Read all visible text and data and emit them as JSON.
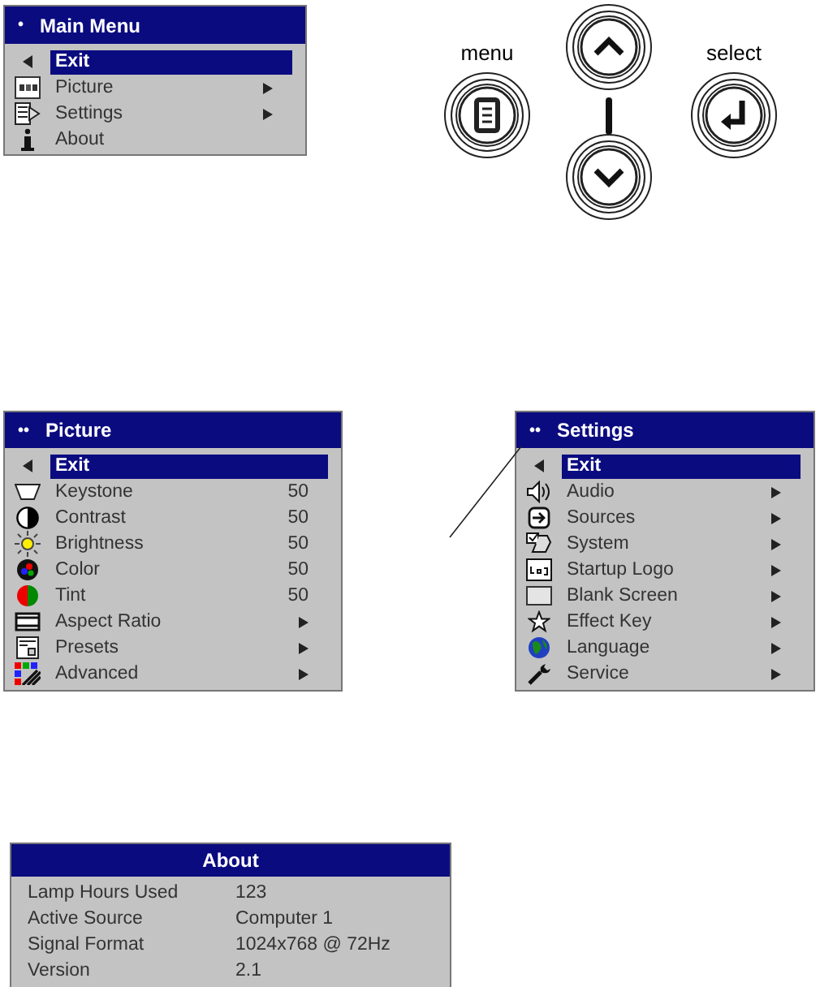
{
  "main_menu": {
    "marker": "•",
    "title": "Main Menu",
    "items": [
      {
        "kind": "exit",
        "label": "Exit",
        "selected": true,
        "submenu": false
      },
      {
        "kind": "picture",
        "label": "Picture",
        "selected": false,
        "submenu": true
      },
      {
        "kind": "settings",
        "label": "Settings",
        "selected": false,
        "submenu": true
      },
      {
        "kind": "about",
        "label": "About",
        "selected": false,
        "submenu": false
      }
    ]
  },
  "remote": {
    "menu_label": "menu",
    "select_label": "select"
  },
  "picture_menu": {
    "marker": "••",
    "title": "Picture",
    "items": [
      {
        "kind": "exit",
        "label": "Exit",
        "selected": true,
        "submenu": false
      },
      {
        "kind": "keystone",
        "label": "Keystone",
        "value": "50",
        "selected": false,
        "submenu": false
      },
      {
        "kind": "contrast",
        "label": "Contrast",
        "value": "50",
        "selected": false,
        "submenu": false
      },
      {
        "kind": "brightness",
        "label": "Brightness",
        "value": "50",
        "selected": false,
        "submenu": false
      },
      {
        "kind": "color",
        "label": "Color",
        "value": "50",
        "selected": false,
        "submenu": false
      },
      {
        "kind": "tint",
        "label": "Tint",
        "value": "50",
        "selected": false,
        "submenu": false
      },
      {
        "kind": "aspect",
        "label": "Aspect Ratio",
        "selected": false,
        "submenu": true
      },
      {
        "kind": "presets",
        "label": "Presets",
        "selected": false,
        "submenu": true
      },
      {
        "kind": "advanced",
        "label": "Advanced",
        "selected": false,
        "submenu": true
      }
    ]
  },
  "settings_menu": {
    "marker": "••",
    "title": "Settings",
    "items": [
      {
        "kind": "exit",
        "label": "Exit",
        "selected": true,
        "submenu": false
      },
      {
        "kind": "audio",
        "label": "Audio",
        "selected": false,
        "submenu": true
      },
      {
        "kind": "sources",
        "label": "Sources",
        "selected": false,
        "submenu": true
      },
      {
        "kind": "system",
        "label": "System",
        "selected": false,
        "submenu": true
      },
      {
        "kind": "logo",
        "label": "Startup Logo",
        "selected": false,
        "submenu": true
      },
      {
        "kind": "blank",
        "label": "Blank Screen",
        "selected": false,
        "submenu": true
      },
      {
        "kind": "effect",
        "label": "Effect Key",
        "selected": false,
        "submenu": true
      },
      {
        "kind": "language",
        "label": "Language",
        "selected": false,
        "submenu": true
      },
      {
        "kind": "service",
        "label": "Service",
        "selected": false,
        "submenu": true
      }
    ]
  },
  "about": {
    "title": "About",
    "rows": [
      {
        "label": "Lamp Hours Used",
        "value": "123"
      },
      {
        "label": "Active Source",
        "value": "Computer 1"
      },
      {
        "label": "Signal Format",
        "value": "1024x768 @ 72Hz"
      },
      {
        "label": "Version",
        "value": "2.1"
      }
    ]
  }
}
